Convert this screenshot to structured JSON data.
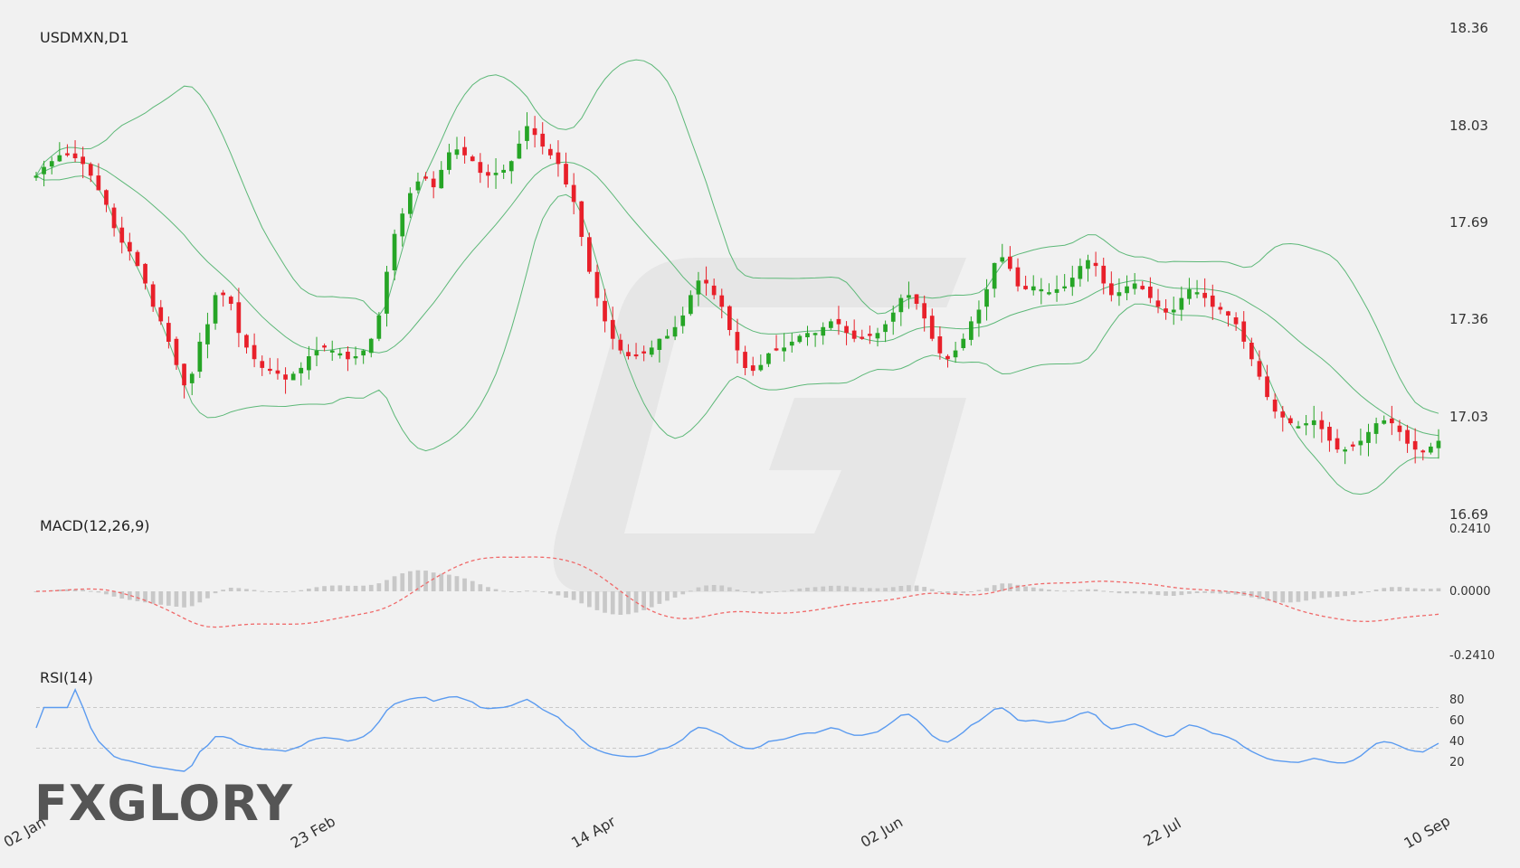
{
  "chart_data": {
    "type": "candlestick",
    "symbol_label": "USDMXN,D1",
    "panes": {
      "main": {
        "label": "USDMXN,D1",
        "y_ticks": [
          "18.36",
          "18.03",
          "17.69",
          "17.36",
          "17.03",
          "16.69"
        ],
        "ylim": [
          16.69,
          18.36
        ],
        "overlays": [
          "Bollinger Bands"
        ]
      },
      "macd": {
        "label": "MACD(12,26,9)",
        "y_ticks": [
          "0.2410",
          "0.0000",
          "-0.2410"
        ],
        "ylim": [
          -0.241,
          0.241
        ]
      },
      "rsi": {
        "label": "RSI(14)",
        "y_ticks": [
          "80",
          "60",
          "40",
          "20"
        ],
        "levels": [
          70,
          30
        ],
        "ylim": [
          10,
          90
        ]
      }
    },
    "x_labels": [
      "02 Jan",
      "23 Feb",
      "14 Apr",
      "02 Jun",
      "22 Jul",
      "10 Sep"
    ],
    "x_label_positions": [
      0,
      37,
      73,
      110,
      146,
      180
    ],
    "closes": [
      17.85,
      17.88,
      17.9,
      17.92,
      17.92,
      17.91,
      17.89,
      17.85,
      17.8,
      17.75,
      17.67,
      17.62,
      17.59,
      17.54,
      17.48,
      17.4,
      17.35,
      17.28,
      17.2,
      17.13,
      17.17,
      17.28,
      17.34,
      17.44,
      17.44,
      17.41,
      17.31,
      17.26,
      17.22,
      17.19,
      17.18,
      17.17,
      17.15,
      17.17,
      17.19,
      17.23,
      17.25,
      17.26,
      17.25,
      17.24,
      17.22,
      17.23,
      17.25,
      17.29,
      17.37,
      17.52,
      17.65,
      17.72,
      17.79,
      17.83,
      17.84,
      17.81,
      17.87,
      17.93,
      17.94,
      17.92,
      17.9,
      17.86,
      17.85,
      17.86,
      17.87,
      17.9,
      17.96,
      18.02,
      17.99,
      17.95,
      17.92,
      17.89,
      17.82,
      17.76,
      17.64,
      17.52,
      17.43,
      17.35,
      17.29,
      17.25,
      17.23,
      17.23,
      17.24,
      17.26,
      17.29,
      17.3,
      17.33,
      17.37,
      17.44,
      17.49,
      17.48,
      17.44,
      17.4,
      17.32,
      17.25,
      17.19,
      17.18,
      17.2,
      17.24,
      17.25,
      17.26,
      17.28,
      17.3,
      17.31,
      17.31,
      17.33,
      17.35,
      17.34,
      17.31,
      17.29,
      17.29,
      17.3,
      17.31,
      17.34,
      17.38,
      17.43,
      17.44,
      17.41,
      17.36,
      17.29,
      17.24,
      17.22,
      17.25,
      17.29,
      17.35,
      17.39,
      17.46,
      17.55,
      17.57,
      17.53,
      17.47,
      17.46,
      17.47,
      17.46,
      17.45,
      17.46,
      17.47,
      17.5,
      17.54,
      17.56,
      17.54,
      17.48,
      17.44,
      17.45,
      17.47,
      17.48,
      17.46,
      17.43,
      17.4,
      17.38,
      17.39,
      17.43,
      17.46,
      17.45,
      17.43,
      17.4,
      17.39,
      17.37,
      17.34,
      17.28,
      17.22,
      17.16,
      17.09,
      17.04,
      17.02,
      17.0,
      16.99,
      17.0,
      17.01,
      16.98,
      16.94,
      16.91,
      16.91,
      16.92,
      16.94,
      16.97,
      17.0,
      17.01,
      17.0,
      16.97,
      16.93,
      16.91,
      16.9,
      16.92,
      16.94
    ],
    "bollinger": {
      "period": 20,
      "deviation": 2
    },
    "macd_params": [
      12,
      26,
      9
    ],
    "rsi_period": 14,
    "colors": {
      "up": "#26a526",
      "down": "#e8202a",
      "band": "#5db878",
      "macd_signal": "#f06a6a",
      "macd_hist": "#c8c8c8",
      "rsi": "#5b9bf0"
    },
    "watermark_logo": "G",
    "brand": "FXGLORY"
  }
}
